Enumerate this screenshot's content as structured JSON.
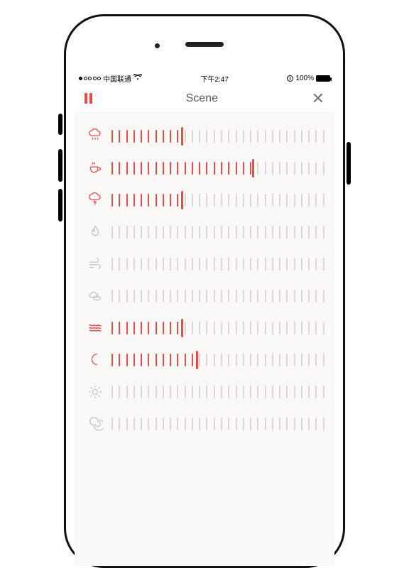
{
  "statusbar": {
    "signal_filled": 1,
    "signal_total": 5,
    "carrier": "中国联通",
    "time": "下午2:47",
    "battery_pct": "100%"
  },
  "navbar": {
    "title": "Scene"
  },
  "slider_ticks": 30,
  "colors": {
    "accent": "#e94b4b",
    "inactive": "#c4c2c0"
  },
  "sounds": [
    {
      "icon": "rain-icon",
      "active": true,
      "level": 10
    },
    {
      "icon": "coffee-icon",
      "active": true,
      "level": 20
    },
    {
      "icon": "thunder-icon",
      "active": true,
      "level": 10
    },
    {
      "icon": "fire-icon",
      "active": false,
      "level": 0
    },
    {
      "icon": "wind-icon",
      "active": false,
      "level": 0
    },
    {
      "icon": "clouds-icon",
      "active": false,
      "level": 0
    },
    {
      "icon": "waves-icon",
      "active": true,
      "level": 10
    },
    {
      "icon": "moon-icon",
      "active": true,
      "level": 12
    },
    {
      "icon": "sun-icon",
      "active": false,
      "level": 0
    },
    {
      "icon": "swirl-icon",
      "active": false,
      "level": 0
    }
  ]
}
